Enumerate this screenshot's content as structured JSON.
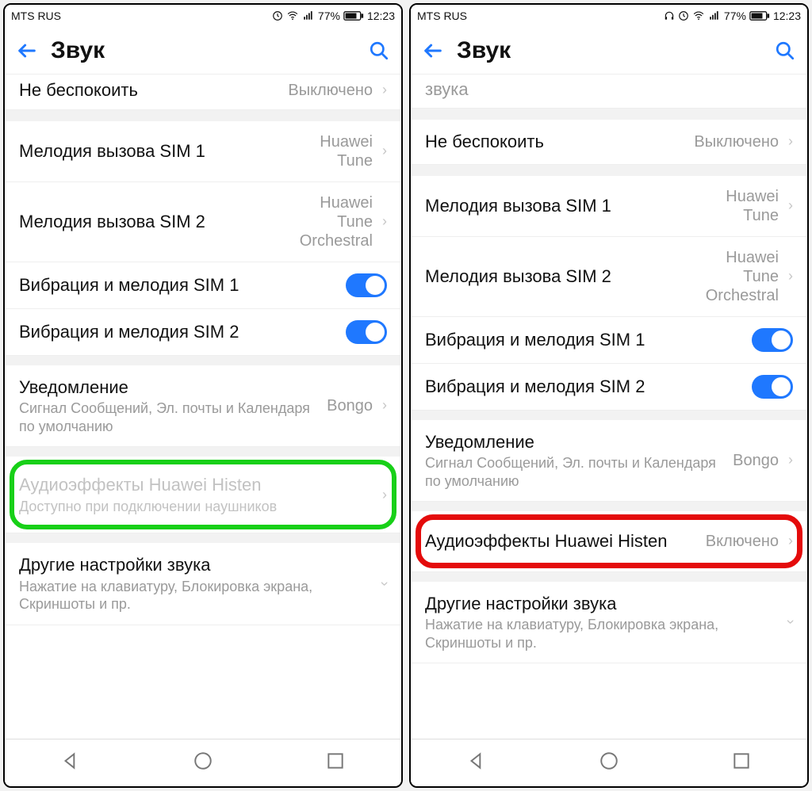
{
  "status": {
    "carrier": "MTS RUS",
    "battery": "77%",
    "time": "12:23"
  },
  "header": {
    "title": "Звук"
  },
  "left": {
    "partialTop": "Не беспокоить",
    "partialTopVal": "Выключено",
    "ring1": {
      "label": "Мелодия вызова SIM 1",
      "value": "Huawei\nTune"
    },
    "ring2": {
      "label": "Мелодия вызова SIM 2",
      "value": "Huawei\nTune\nOrchestral"
    },
    "vib1": "Вибрация и мелодия SIM 1",
    "vib2": "Вибрация и мелодия SIM 2",
    "notif": {
      "label": "Уведомление",
      "sub": "Сигнал Сообщений, Эл. почты и Календаря по умолчанию",
      "value": "Bongo"
    },
    "histen": {
      "label": "Аудиоэффекты Huawei Histen",
      "sub": "Доступно при подключении наушников"
    },
    "other": {
      "label": "Другие настройки звука",
      "sub": "Нажатие на клавиатуру, Блокировка экрана, Скриншоты и пр."
    }
  },
  "right": {
    "scrollCut": "звука",
    "dnd": {
      "label": "Не беспокоить",
      "value": "Выключено"
    },
    "ring1": {
      "label": "Мелодия вызова SIM 1",
      "value": "Huawei\nTune"
    },
    "ring2": {
      "label": "Мелодия вызова SIM 2",
      "value": "Huawei\nTune\nOrchestral"
    },
    "vib1": "Вибрация и мелодия SIM 1",
    "vib2": "Вибрация и мелодия SIM 2",
    "notif": {
      "label": "Уведомление",
      "sub": "Сигнал Сообщений, Эл. почты и Календаря по умолчанию",
      "value": "Bongo"
    },
    "histen": {
      "label": "Аудиоэффекты Huawei Histen",
      "value": "Включено"
    },
    "other": {
      "label": "Другие настройки звука",
      "sub": "Нажатие на клавиатуру, Блокировка экрана, Скриншоты и пр."
    }
  }
}
